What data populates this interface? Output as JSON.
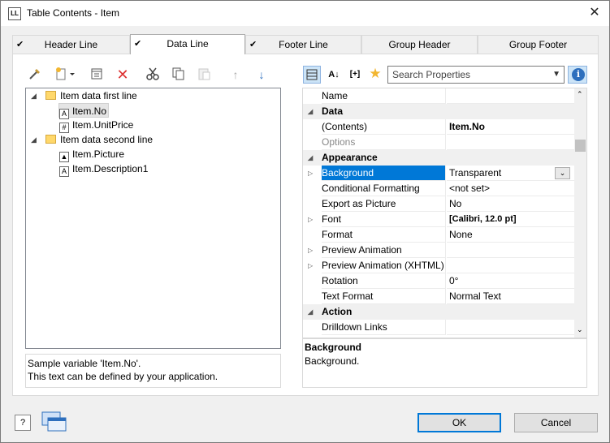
{
  "window": {
    "title": "Table Contents - Item",
    "app_icon": "LL",
    "close": "✕"
  },
  "tabs": [
    {
      "label": "Header Line",
      "checked": true
    },
    {
      "label": "Data Line",
      "checked": true,
      "active": true
    },
    {
      "label": "Footer Line",
      "checked": true
    },
    {
      "label": "Group Header",
      "checked": false
    },
    {
      "label": "Group Footer",
      "checked": false
    }
  ],
  "tree": {
    "items": [
      {
        "label": "Item data first line",
        "type": "folder"
      },
      {
        "label": "Item.No",
        "type": "text-field",
        "selected": true
      },
      {
        "label": "Item.UnitPrice",
        "type": "number-field"
      },
      {
        "label": "Item data second line",
        "type": "folder"
      },
      {
        "label": "Item.Picture",
        "type": "picture-field"
      },
      {
        "label": "Item.Description1",
        "type": "text-field"
      }
    ]
  },
  "tree_description": {
    "line1": "Sample variable 'Item.No'.",
    "line2": "This text can be defined by your application."
  },
  "search": {
    "placeholder": "Search Properties"
  },
  "properties": {
    "rows": [
      {
        "name": "Name",
        "value": ""
      },
      {
        "name": "Data",
        "category": true
      },
      {
        "name": "(Contents)",
        "value": "Item.No"
      },
      {
        "name": "Options",
        "value": ""
      },
      {
        "name": "Appearance",
        "category": true
      },
      {
        "name": "Background",
        "value": "Transparent",
        "selected": true
      },
      {
        "name": "Conditional Formatting",
        "value": "<not set>"
      },
      {
        "name": "Export as Picture",
        "value": "No"
      },
      {
        "name": "Font",
        "value": "[Calibri, 12.0 pt]"
      },
      {
        "name": "Format",
        "value": "None"
      },
      {
        "name": "Preview Animation",
        "value": ""
      },
      {
        "name": "Preview Animation (XHTML)",
        "value": ""
      },
      {
        "name": "Rotation",
        "value": "0°"
      },
      {
        "name": "Text Format",
        "value": "Normal Text"
      },
      {
        "name": "Action",
        "category": true
      },
      {
        "name": "Drilldown Links",
        "value": ""
      }
    ]
  },
  "property_description": {
    "title": "Background",
    "text": "Background."
  },
  "buttons": {
    "ok": "OK",
    "cancel": "Cancel"
  },
  "colors": {
    "accent": "#0078d7",
    "folder": "#ffd86b"
  }
}
